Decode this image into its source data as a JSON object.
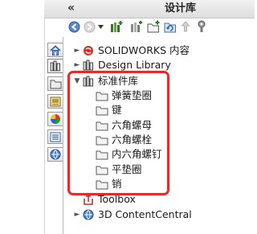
{
  "panel": {
    "collapse_label": "«",
    "title": "设计库"
  },
  "toolbar": {
    "icons": [
      "back-icon",
      "forward-icon",
      "dropdown-icon",
      "add-to-library-icon",
      "add-file-location-icon",
      "create-new-folder-icon",
      "refresh-icon",
      "up-one-level-icon",
      "options-icon"
    ]
  },
  "sidetabs": [
    "home-icon",
    "design-library-icon",
    "file-explorer-icon",
    "view-palette-icon",
    "appearances-icon",
    "custom-properties-icon",
    "solidworks-forum-icon"
  ],
  "tree": {
    "solidworks_content": "SOLIDWORKS 内容",
    "design_library": "Design Library",
    "standard_parts": "标准件库",
    "children": [
      "弹簧垫圈",
      "键",
      "六角螺母",
      "六角螺栓",
      "内六角螺钉",
      "平垫圈",
      "销"
    ],
    "toolbox": "Toolbox",
    "content_central": "3D ContentCentral"
  },
  "colors": {
    "highlight_box": "#e82a2a",
    "folder_fill": "#f3f3f3",
    "folder_stroke": "#5a5a5a"
  }
}
